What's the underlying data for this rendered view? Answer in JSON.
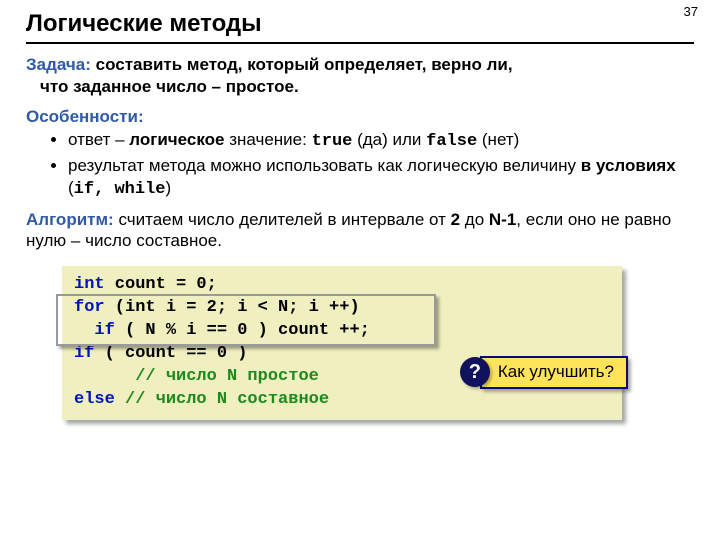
{
  "page_number": "37",
  "title": "Логические методы",
  "task": {
    "label": "Задача:",
    "text_line1": " составить метод, который определяет, верно ли,",
    "text_line2": "что заданное число – простое."
  },
  "features": {
    "label": "Особенности:",
    "bullet1_pre": "ответ – ",
    "bullet1_bold": "логическое",
    "bullet1_mid": " значение: ",
    "bullet1_true": "true",
    "bullet1_da": " (да) или ",
    "bullet1_false": "false",
    "bullet1_net": " (нет)",
    "bullet2_pre": "результат метода можно использовать как логическую величину ",
    "bullet2_bold": "в условиях",
    "bullet2_paren_open": " (",
    "bullet2_code": "if, while",
    "bullet2_paren_close": ")"
  },
  "algorithm": {
    "label": "Алгоритм:",
    "text_a": " считаем число делителей в интервале от ",
    "two": "2",
    "text_b": " до ",
    "n1": "N-1",
    "text_c": ", если оно не равно нулю – число составное."
  },
  "code": {
    "l1_kw": "int",
    "l1_rest": " count = 0;",
    "l2_kw": "for",
    "l2_mid": " (int i = 2; i < N; i ++)",
    "l3_indent": "  ",
    "l3_kw": "if",
    "l3_rest": " ( N % i == 0 ) count ++;",
    "l4_kw": "if",
    "l4_rest": " ( count == 0 )",
    "l5_indent": "      ",
    "l5_cm": "// число N простое",
    "l6_kw": "else",
    "l6_sp": " ",
    "l6_cm": "// число N составное"
  },
  "callout": {
    "mark": "?",
    "text": "Как улучшить?"
  }
}
